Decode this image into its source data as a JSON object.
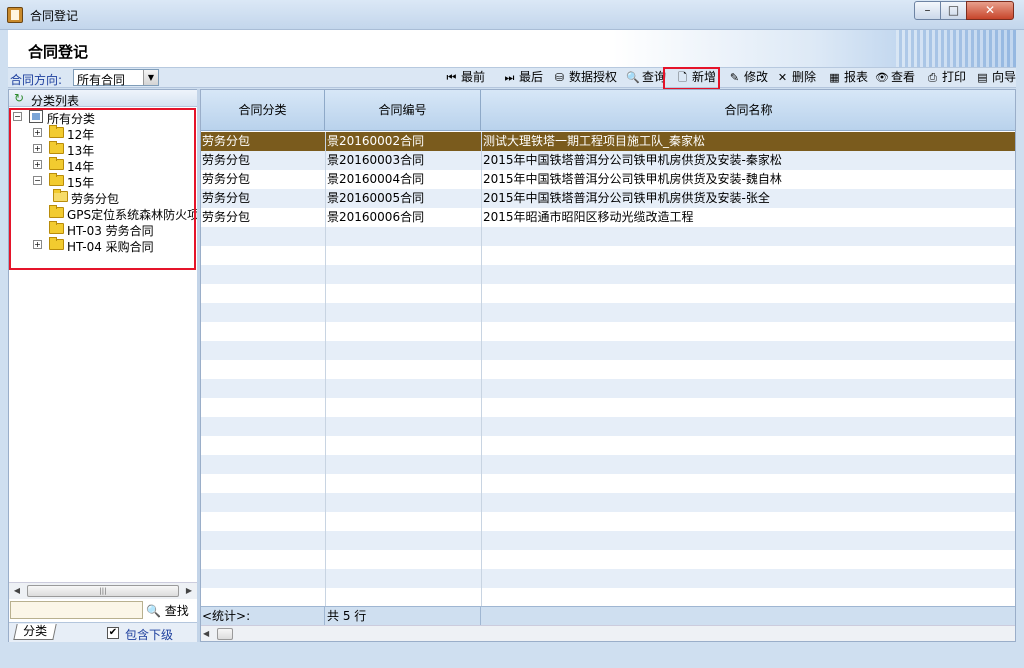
{
  "window": {
    "title": "合同登记",
    "min": "–",
    "max": "□",
    "close": "✕"
  },
  "page": {
    "title": "合同登记"
  },
  "toolbar": {
    "direction_label": "合同方向:",
    "direction_value": "所有合同",
    "buttons": [
      {
        "label": "最前",
        "icon": "first-icon",
        "glyph": "⏮"
      },
      {
        "label": "最后",
        "icon": "last-icon",
        "glyph": "⏭"
      },
      {
        "label": "数据授权",
        "icon": "authorize-icon",
        "glyph": "⛁"
      },
      {
        "label": "查询",
        "icon": "search-icon",
        "glyph": "🔍"
      },
      {
        "label": "新增",
        "icon": "add-doc-icon",
        "glyph": "🗋"
      },
      {
        "label": "修改",
        "icon": "edit-icon",
        "glyph": "✎"
      },
      {
        "label": "删除",
        "icon": "delete-icon",
        "glyph": "✕"
      },
      {
        "label": "报表",
        "icon": "report-icon",
        "glyph": "▦"
      },
      {
        "label": "查看",
        "icon": "view-icon",
        "glyph": "👁"
      },
      {
        "label": "打印",
        "icon": "print-icon",
        "glyph": "⎙"
      },
      {
        "label": "向导",
        "icon": "wizard-icon",
        "glyph": "▤"
      }
    ]
  },
  "left_panel": {
    "title": "分类列表",
    "tree": [
      {
        "label": "所有分类",
        "level": 0,
        "expander": "−",
        "icon": "root"
      },
      {
        "label": "12年",
        "level": 1,
        "expander": "+",
        "icon": "folder"
      },
      {
        "label": "13年",
        "level": 1,
        "expander": "+",
        "icon": "folder"
      },
      {
        "label": "14年",
        "level": 1,
        "expander": "+",
        "icon": "folder"
      },
      {
        "label": "15年",
        "level": 1,
        "expander": "−",
        "icon": "folder"
      },
      {
        "label": "劳务分包",
        "level": 2,
        "expander": "",
        "icon": "folder-open"
      },
      {
        "label": "GPS定位系统森林防火项",
        "level": 1,
        "expander": "",
        "icon": "folder"
      },
      {
        "label": "HT-03 劳务合同",
        "level": 1,
        "expander": "",
        "icon": "folder"
      },
      {
        "label": "HT-04 采购合同",
        "level": 1,
        "expander": "+",
        "icon": "folder"
      }
    ],
    "find_label": "查找",
    "tab_label": "分类",
    "include_sub_label": "包含下级",
    "include_sub_checked": true
  },
  "grid": {
    "columns": [
      "合同分类",
      "合同编号",
      "合同名称"
    ],
    "rows": [
      {
        "category": "劳务分包",
        "number": "景20160002合同",
        "name": "测试大理铁塔一期工程项目施工队_秦家松",
        "selected": true
      },
      {
        "category": "劳务分包",
        "number": "景20160003合同",
        "name": "2015年中国铁塔普洱分公司铁甲机房供货及安装-秦家松"
      },
      {
        "category": "劳务分包",
        "number": "景20160004合同",
        "name": "2015年中国铁塔普洱分公司铁甲机房供货及安装-魏自林"
      },
      {
        "category": "劳务分包",
        "number": "景20160005合同",
        "name": "2015年中国铁塔普洱分公司铁甲机房供货及安装-张全"
      },
      {
        "category": "劳务分包",
        "number": "景20160006合同",
        "name": "2015年昭通市昭阳区移动光缆改造工程"
      }
    ],
    "footer": {
      "label": "<统计>:",
      "count": "共 5 行"
    }
  }
}
